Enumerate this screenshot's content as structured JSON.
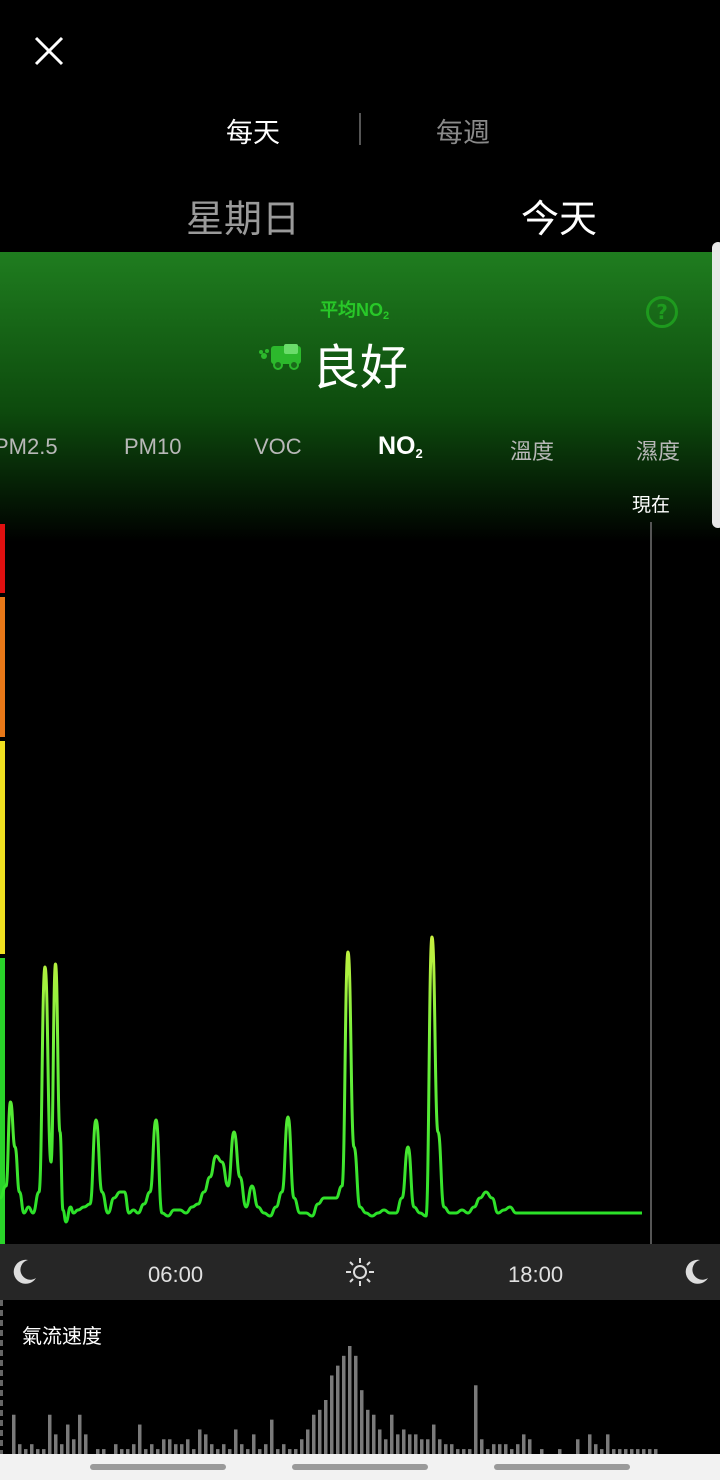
{
  "period": {
    "daily": "每天",
    "weekly": "每週"
  },
  "days": {
    "previous": "星期日",
    "current": "今天"
  },
  "summary": {
    "label": "平均NO",
    "label_sub": "2",
    "status": "良好",
    "help": "?"
  },
  "metrics": [
    {
      "label": "PM2.5",
      "sub": ""
    },
    {
      "label": "PM10",
      "sub": ""
    },
    {
      "label": "VOC",
      "sub": ""
    },
    {
      "label": "NO",
      "sub": "2"
    },
    {
      "label": "溫度",
      "sub": ""
    },
    {
      "label": "濕度",
      "sub": ""
    }
  ],
  "active_metric": "NO2",
  "now_label": "現在",
  "time_axis": {
    "ticks": [
      "06:00",
      "18:00"
    ]
  },
  "airflow_title": "氣流速度",
  "colors": {
    "good": "#2ad42a",
    "moderate": "#f0e020",
    "unhealthy": "#e87818",
    "hazardous": "#e01010",
    "line": "#3ce83c"
  },
  "icons": {
    "close": "close-icon",
    "help": "question-circle-icon",
    "car": "car-icon",
    "moon": "moon-icon",
    "sun": "sun-icon"
  },
  "chart_data": {
    "type": "line",
    "x_range": [
      "00:00",
      "24:00"
    ],
    "series": [
      {
        "x_hours": [
          0.0,
          0.2,
          0.35,
          0.5,
          0.65,
          0.8,
          0.95,
          1.1,
          1.3,
          1.5,
          1.7,
          1.85,
          2.0,
          2.1,
          2.2,
          2.35,
          2.45,
          2.6,
          2.8,
          3.0,
          3.2,
          3.4,
          3.6,
          3.8,
          4.0,
          4.15,
          4.3,
          4.45,
          4.6,
          4.8,
          5.0,
          5.2,
          5.4,
          5.6,
          5.8,
          6.0,
          6.2,
          6.4,
          6.6,
          6.8,
          7.0,
          7.2,
          7.4,
          7.6,
          7.8,
          8.0,
          8.2,
          8.4,
          8.6,
          8.8,
          9.0,
          9.2,
          9.4,
          9.6,
          9.8,
          10.0,
          10.2,
          10.4,
          10.6,
          10.8,
          11.0,
          11.2,
          11.4,
          11.6,
          11.8,
          12.0,
          12.2,
          12.4,
          12.6,
          12.8,
          13.0,
          13.2,
          13.4,
          13.6,
          13.8,
          14.0,
          14.2,
          14.4,
          14.6,
          14.8,
          15.0,
          15.2,
          15.4,
          15.6,
          15.8,
          16.0,
          16.2,
          16.4,
          16.6,
          16.8,
          17.0,
          17.2,
          17.4,
          17.6,
          17.8,
          18.0,
          18.2,
          18.4,
          18.6,
          18.8,
          19.0,
          19.2,
          19.4,
          19.6,
          19.8,
          20.0,
          20.2,
          20.4,
          20.6,
          20.8,
          21.0,
          21.2,
          21.4
        ],
        "values": [
          8,
          12,
          40,
          25,
          10,
          3,
          5,
          3,
          10,
          85,
          20,
          86,
          30,
          4,
          0,
          5,
          3,
          4,
          5,
          6,
          34,
          10,
          3,
          8,
          10,
          10,
          3,
          4,
          3,
          6,
          10,
          34,
          3,
          2,
          4,
          4,
          3,
          5,
          6,
          10,
          15,
          22,
          20,
          12,
          30,
          15,
          5,
          12,
          5,
          3,
          2,
          5,
          10,
          35,
          8,
          3,
          3,
          2,
          6,
          8,
          8,
          8,
          12,
          90,
          25,
          5,
          3,
          2,
          3,
          4,
          3,
          3,
          8,
          25,
          5,
          3,
          2,
          95,
          30,
          5,
          3,
          3,
          4,
          3,
          5,
          8,
          10,
          8,
          3,
          4,
          5,
          3,
          3,
          3,
          3,
          3,
          3,
          3,
          3,
          3,
          3,
          3,
          3,
          3,
          3,
          3,
          3,
          3,
          3,
          3,
          3,
          3,
          3
        ]
      }
    ],
    "grid": false
  },
  "airflow_data": {
    "type": "bar",
    "values": [
      8,
      2,
      1,
      2,
      1,
      1,
      8,
      4,
      2,
      6,
      3,
      8,
      4,
      0,
      1,
      1,
      0,
      2,
      1,
      1,
      2,
      6,
      1,
      2,
      1,
      3,
      3,
      2,
      2,
      3,
      1,
      5,
      4,
      2,
      1,
      2,
      1,
      5,
      2,
      1,
      4,
      1,
      2,
      7,
      1,
      2,
      1,
      1,
      3,
      5,
      8,
      9,
      11,
      16,
      18,
      20,
      22,
      20,
      13,
      9,
      8,
      5,
      3,
      8,
      4,
      5,
      4,
      4,
      3,
      3,
      6,
      3,
      2,
      2,
      1,
      1,
      1,
      14,
      3,
      1,
      2,
      2,
      2,
      1,
      2,
      4,
      3,
      0,
      1,
      0,
      0,
      1,
      0,
      0,
      3,
      0,
      4,
      2,
      1,
      4,
      1,
      1,
      1,
      1,
      1,
      1,
      1,
      1
    ]
  }
}
